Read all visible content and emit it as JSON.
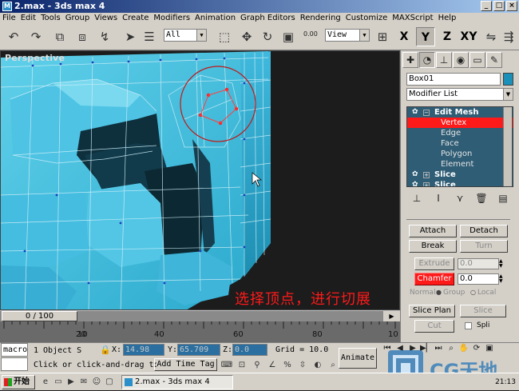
{
  "window": {
    "title": "2.max - 3ds max 4",
    "buttons": [
      "_",
      "□",
      "×"
    ]
  },
  "menu": [
    "File",
    "Edit",
    "Tools",
    "Group",
    "Views",
    "Create",
    "Modifiers",
    "Animation",
    "Graph Editors",
    "Rendering",
    "Customize",
    "MAXScript",
    "Help"
  ],
  "toolbar": {
    "icons": [
      "undo-icon",
      "redo-icon",
      "link-icon",
      "unlink-icon",
      "bind-space-warp-icon",
      "select-icon",
      "select-by-name-icon",
      "select-region-icon"
    ],
    "selection_filter": "All",
    "spinner_snap": "0.00",
    "reference_coord": "View",
    "axes": [
      "X",
      "Y",
      "Z",
      "XY"
    ],
    "active_axis": "Y"
  },
  "viewport": {
    "label": "Perspective",
    "subtitle": "选择顶点，进行切展"
  },
  "command_panel": {
    "object_name": "Box01",
    "object_color": "#1a8fb8",
    "modifier_list": "Modifier List",
    "stack": [
      {
        "label": "Edit Mesh",
        "level": 0,
        "selected": false
      },
      {
        "label": "Vertex",
        "level": 1,
        "selected": true
      },
      {
        "label": "Edge",
        "level": 1,
        "selected": false
      },
      {
        "label": "Face",
        "level": 1,
        "selected": false
      },
      {
        "label": "Polygon",
        "level": 1,
        "selected": false
      },
      {
        "label": "Element",
        "level": 1,
        "selected": false
      },
      {
        "label": "Slice",
        "level": 0,
        "selected": false
      },
      {
        "label": "Slice",
        "level": 0,
        "selected": false
      }
    ],
    "edit_geometry": {
      "attach": "Attach",
      "detach": "Detach",
      "break": "Break",
      "turn": "Turn",
      "extrude": "Extrude",
      "extrude_value": "0.0",
      "chamfer": "Chamfer",
      "chamfer_value": "0.0",
      "normal_label": "Normal:",
      "group": "Group",
      "local": "Local",
      "slice_plane": "Slice Plan",
      "slice": "Slice",
      "cut": "Cut",
      "split": "Spli"
    }
  },
  "timeline": {
    "slider": "0 / 100",
    "ticks": [
      "10",
      "20",
      "30",
      "40",
      "50",
      "60",
      "70",
      "80",
      "90",
      "100"
    ],
    "tick_labels_shown": [
      "10",
      "20",
      "40",
      "60",
      "80",
      "10"
    ]
  },
  "status": {
    "macro": "macro",
    "selection": "1 Object S",
    "x_label": "X:",
    "x_value": "14.98",
    "y_label": "Y:",
    "y_value": "65.709",
    "z_label": "Z:",
    "z_value": "0.0",
    "grid": "Grid = 10.0",
    "prompt": "Click or click-and-drag to",
    "add_time_tag": "Add Time Tag",
    "animate": "Animate"
  },
  "taskbar": {
    "start": "开始",
    "item": "2.max - 3ds max 4",
    "clock": "21:13"
  },
  "watermark": "CG天地"
}
